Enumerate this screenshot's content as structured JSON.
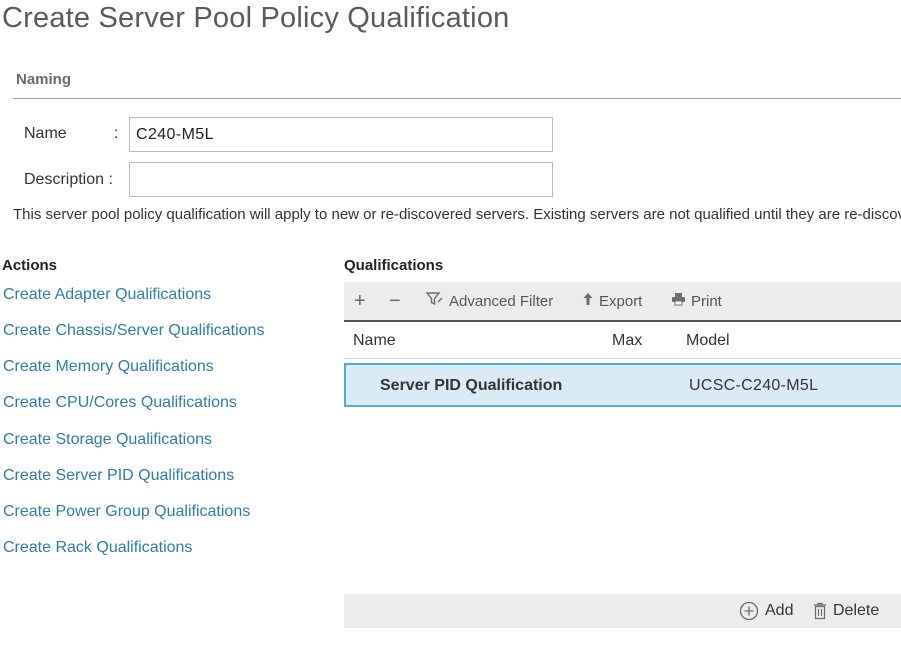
{
  "page": {
    "title": "Create Server Pool Policy Qualification"
  },
  "naming": {
    "section_label": "Naming",
    "name_label": "Name",
    "name_colon": ":",
    "name_value": "C240-M5L",
    "description_label": "Description :",
    "description_value": "",
    "info_text": "This server pool policy qualification will apply to new or re-discovered servers. Existing servers are not qualified until they are re-discovered"
  },
  "actions": {
    "heading": "Actions",
    "links": [
      "Create Adapter Qualifications",
      "Create Chassis/Server Qualifications",
      "Create Memory Qualifications",
      "Create CPU/Cores Qualifications",
      "Create Storage Qualifications",
      "Create Server PID Qualifications",
      "Create Power Group Qualifications",
      "Create Rack Qualifications"
    ]
  },
  "qualifications": {
    "heading": "Qualifications",
    "toolbar": {
      "add_symbol": "+",
      "remove_symbol": "−",
      "advanced_filter": "Advanced Filter",
      "export": "Export",
      "print": "Print",
      "icons": [
        "plus-icon",
        "minus-icon",
        "filter-icon",
        "export-icon",
        "print-icon"
      ]
    },
    "columns": [
      "Name",
      "Max",
      "Model"
    ],
    "rows": [
      {
        "name": "Server PID Qualification",
        "max": "",
        "model": "UCSC-C240-M5L",
        "selected": true
      }
    ],
    "footer": {
      "add": "Add",
      "delete": "Delete",
      "icons": [
        "add-circle-icon",
        "trash-icon"
      ]
    }
  },
  "colors": {
    "link": "#2f7ca8",
    "selected_row_bg": "#d9ebf5",
    "selected_row_border": "#53a9da",
    "toolbar_bg": "#ececec"
  }
}
